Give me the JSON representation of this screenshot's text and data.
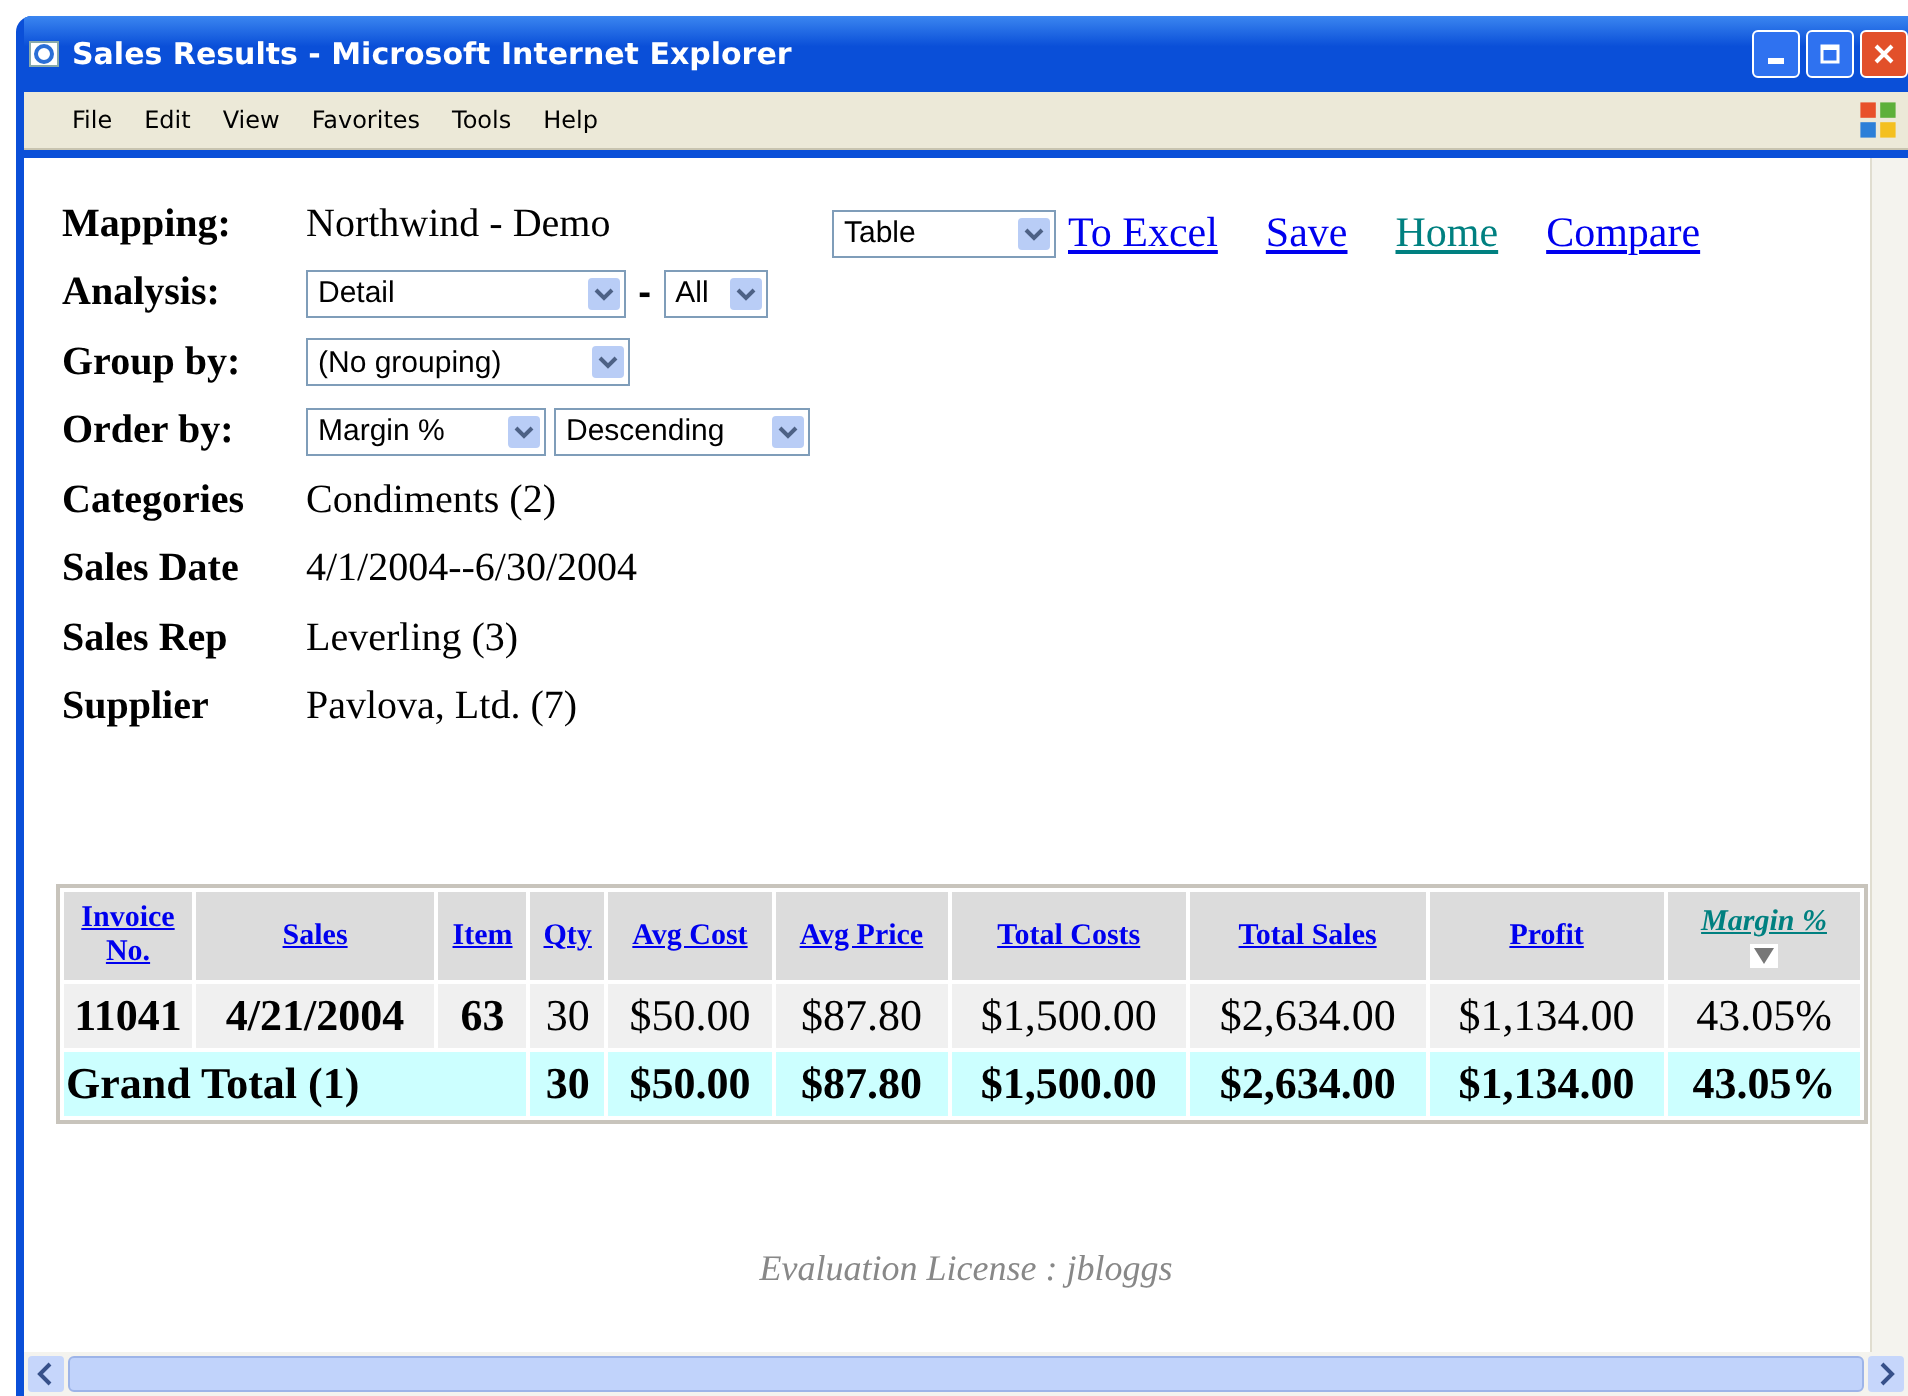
{
  "window": {
    "title": "Sales Results - Microsoft Internet Explorer"
  },
  "menu": [
    "File",
    "Edit",
    "View",
    "Favorites",
    "Tools",
    "Help"
  ],
  "view_select": {
    "value": "Table"
  },
  "links": [
    {
      "label": "To Excel",
      "visited": false
    },
    {
      "label": "Save",
      "visited": false
    },
    {
      "label": "Home",
      "visited": true
    },
    {
      "label": "Compare",
      "visited": false
    }
  ],
  "filters": [
    {
      "label": "Mapping:",
      "kind": "text",
      "value": "Northwind - Demo"
    },
    {
      "label": "Analysis:",
      "kind": "selects",
      "selects": [
        "Detail",
        "All"
      ],
      "separator": "-"
    },
    {
      "label": "Group by:",
      "kind": "selects",
      "selects": [
        "(No grouping)"
      ]
    },
    {
      "label": "Order by:",
      "kind": "selects",
      "selects": [
        "Margin %",
        "Descending"
      ]
    },
    {
      "label": "Categories",
      "kind": "text",
      "value": "Condiments (2)"
    },
    {
      "label": "Sales Date",
      "kind": "text",
      "value": "4/1/2004--6/30/2004"
    },
    {
      "label": "Sales Rep",
      "kind": "text",
      "value": "Leverling (3)"
    },
    {
      "label": "Supplier",
      "kind": "text",
      "value": "Pavlova, Ltd. (7)"
    }
  ],
  "table": {
    "columns": [
      {
        "label": "Invoice No.",
        "sorted": false,
        "visited": false
      },
      {
        "label": "Sales",
        "sorted": false,
        "visited": false
      },
      {
        "label": "Item",
        "sorted": false,
        "visited": false
      },
      {
        "label": "Qty",
        "sorted": false,
        "visited": false
      },
      {
        "label": "Avg Cost",
        "sorted": false,
        "visited": false
      },
      {
        "label": "Avg Price",
        "sorted": false,
        "visited": false
      },
      {
        "label": "Total Costs",
        "sorted": false,
        "visited": false
      },
      {
        "label": "Total Sales",
        "sorted": false,
        "visited": false
      },
      {
        "label": "Profit",
        "sorted": false,
        "visited": false
      },
      {
        "label": "Margin %",
        "sorted": true,
        "visited": true
      }
    ],
    "rows": [
      {
        "cells": [
          "11041",
          "4/21/2004",
          "63",
          "30",
          "$50.00",
          "$87.80",
          "$1,500.00",
          "$2,634.00",
          "$1,134.00",
          "43.05%"
        ]
      }
    ],
    "total": {
      "label": "Grand Total (1)",
      "cells": [
        "30",
        "$50.00",
        "$87.80",
        "$1,500.00",
        "$2,634.00",
        "$1,134.00",
        "43.05%"
      ]
    }
  },
  "footer": "Evaluation License : jbloggs"
}
